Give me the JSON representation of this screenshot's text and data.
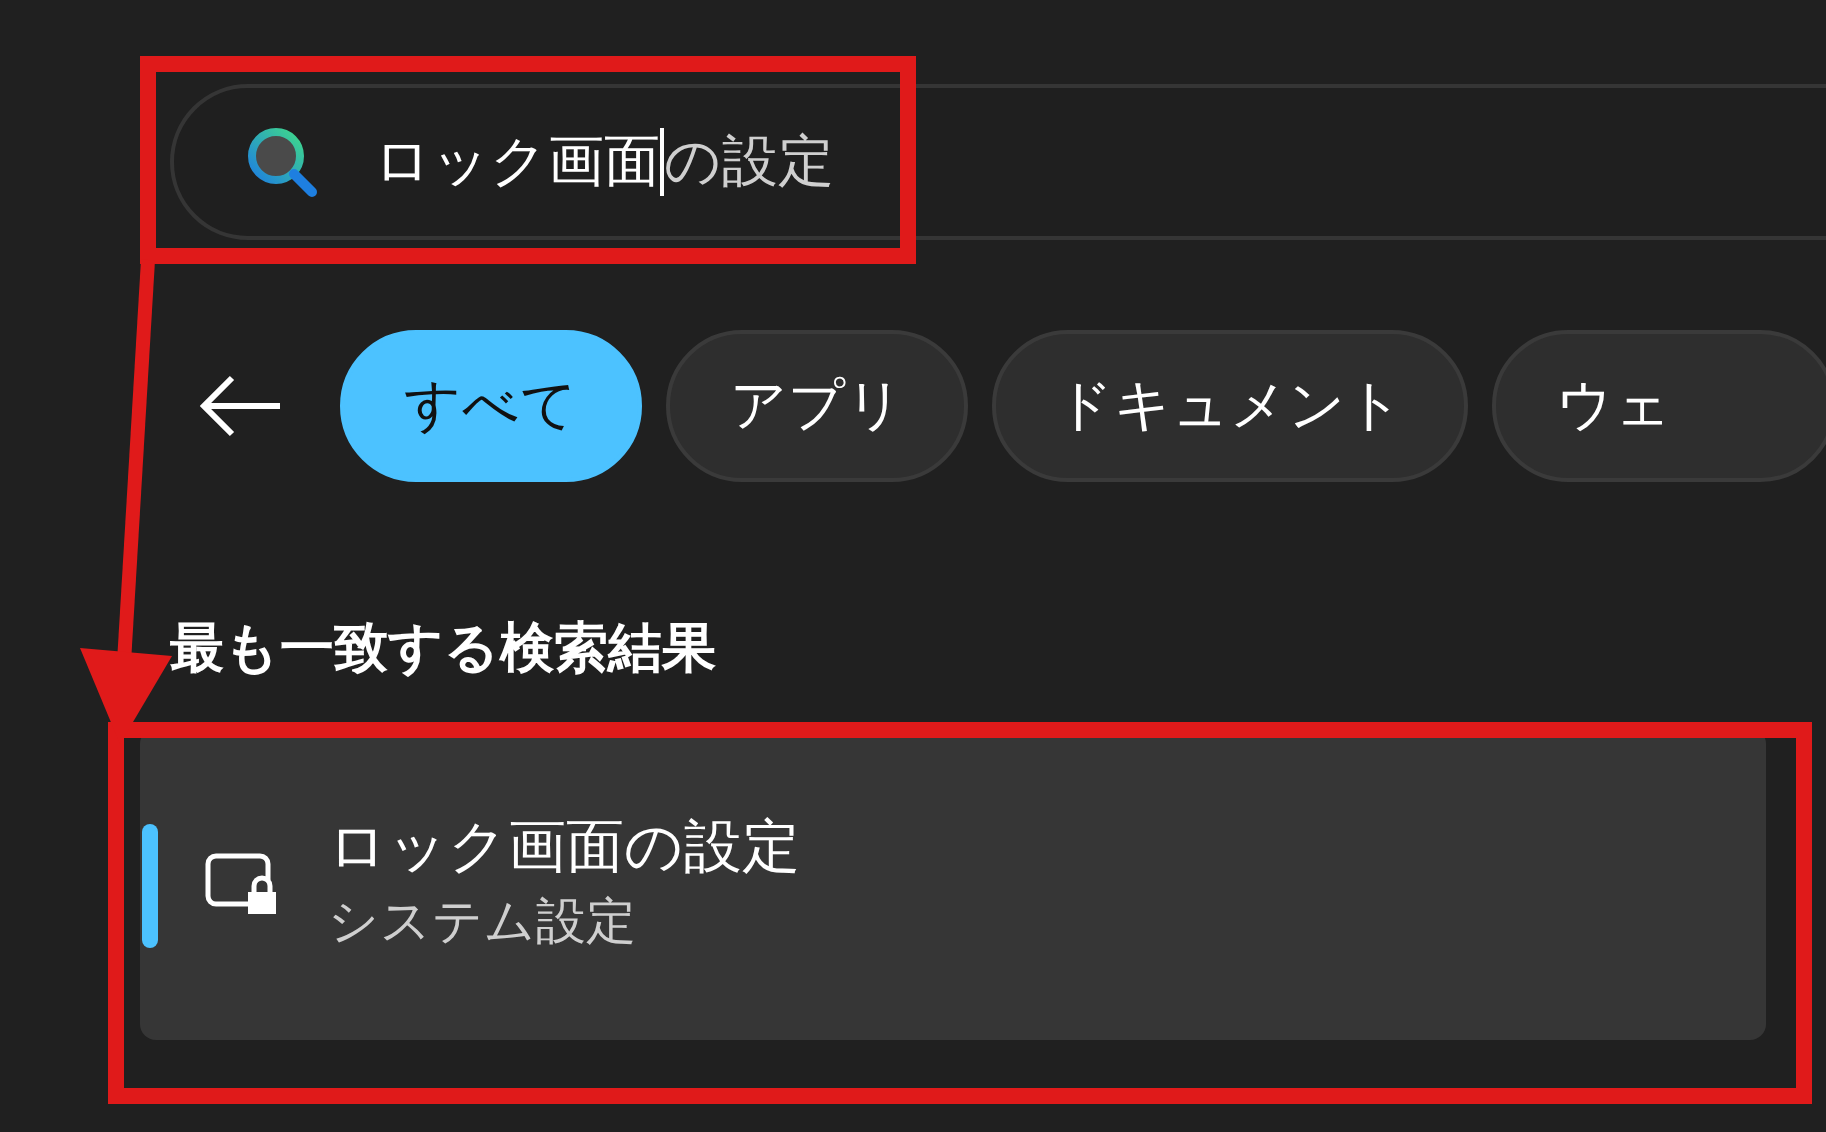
{
  "search": {
    "typed": "ロック画面",
    "completion": "の設定",
    "focused": true
  },
  "filters": [
    {
      "label": "すべて",
      "selected": true
    },
    {
      "label": "アプリ",
      "selected": false
    },
    {
      "label": "ドキュメント",
      "selected": false
    },
    {
      "label": "ウェ",
      "selected": false
    }
  ],
  "section_heading": "最も一致する検索結果",
  "results": [
    {
      "title": "ロック画面の設定",
      "subtitle": "システム設定",
      "selected": true
    }
  ]
}
